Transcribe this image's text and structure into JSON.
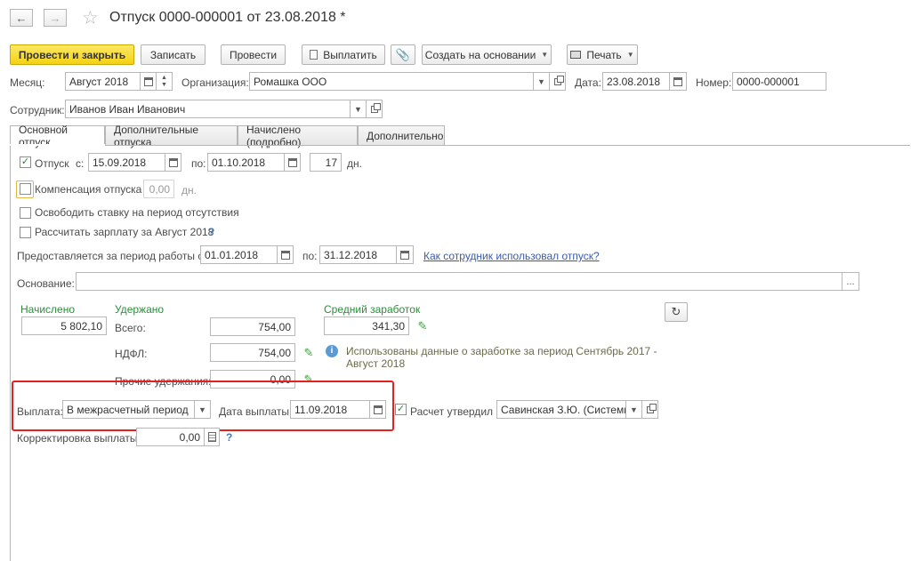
{
  "header": {
    "title": "Отпуск 0000-000001 от 23.08.2018 *",
    "back_icon": "arrow-left-icon",
    "forward_icon": "arrow-right-icon",
    "star_icon": "star-icon"
  },
  "toolbar": {
    "post_close": "Провести и закрыть",
    "save": "Записать",
    "post": "Провести",
    "pay": "Выплатить",
    "create_base": "Создать на основании",
    "print": "Печать"
  },
  "form": {
    "month_label": "Месяц:",
    "month_value": "Август 2018",
    "org_label": "Организация:",
    "org_value": "Ромашка ООО",
    "date_label": "Дата:",
    "date_value": "23.08.2018",
    "number_label": "Номер:",
    "number_value": "0000-000001",
    "employee_label": "Сотрудник:",
    "employee_value": "Иванов Иван Иванович"
  },
  "tabs": [
    {
      "label": "Основной отпуск"
    },
    {
      "label": "Дополнительные отпуска"
    },
    {
      "label": "Начислено (подробно)"
    },
    {
      "label": "Дополнительно"
    }
  ],
  "vacation": {
    "label": "Отпуск",
    "from_label": "с:",
    "from_value": "15.09.2018",
    "to_label": "по:",
    "to_value": "01.10.2018",
    "days_value": "17",
    "days_unit": "дн.",
    "checked": true
  },
  "compensation": {
    "label": "Компенсация отпуска",
    "value": "0,00",
    "unit": "дн."
  },
  "free_rate_label": "Освободить ставку на период отсутствия",
  "calc_salary_label": "Рассчитать зарплату за Август 2018",
  "help_mark": "?",
  "work_period": {
    "label": "Предоставляется за период работы с:",
    "from_value": "01.01.2018",
    "to_label": "по:",
    "to_value": "31.12.2018",
    "link": "Как сотрудник использовал отпуск?"
  },
  "basis": {
    "label": "Основание:",
    "value": "",
    "btn": "..."
  },
  "amounts": {
    "accrued_label": "Начислено",
    "accrued_value": "5 802,10",
    "withheld_label": "Удержано",
    "total_label": "Всего:",
    "total_value": "754,00",
    "ndfl_label": "НДФЛ:",
    "ndfl_value": "754,00",
    "other_label": "Прочие удержания:",
    "other_value": "0,00",
    "avg_label": "Средний заработок",
    "avg_value": "341,30",
    "info_text_1": "Использованы данные о заработке за период Сентябрь 2017 -",
    "info_text_2": "Август 2018"
  },
  "payment": {
    "label": "Выплата:",
    "value": "В межрасчетный период",
    "date_label": "Дата выплаты:",
    "date_value": "11.09.2018",
    "approved_label": "Расчет утвердил",
    "approved_value": "Савинская З.Ю. (Системн",
    "correction_label": "Корректировка выплаты:",
    "correction_value": "0,00"
  },
  "colors": {
    "primary_button": "#f5d112",
    "section_green": "#2e8b3c",
    "highlight_red": "#e32121",
    "link_blue": "#3a5ba9"
  }
}
